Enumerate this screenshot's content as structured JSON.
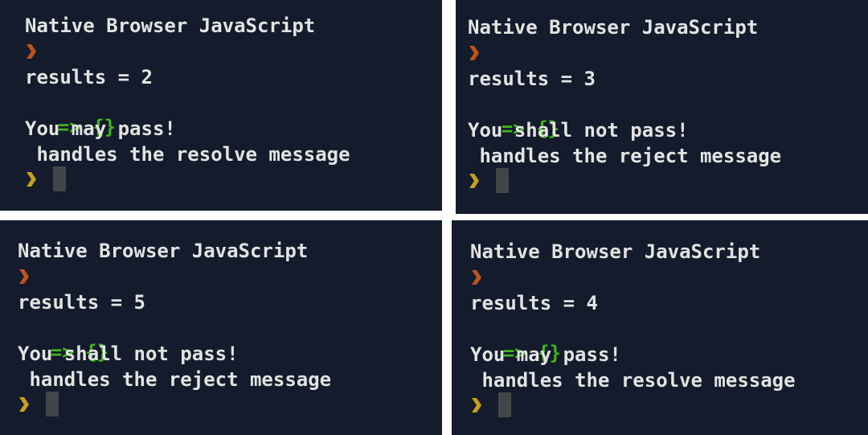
{
  "panels": [
    {
      "title": "Native Browser JavaScript",
      "results_line": "results = 2",
      "return_arrow": "=>",
      "return_value": "{}",
      "message": "You may pass!",
      "handler_line": " handles the resolve message",
      "prompt_icon": "chevron-prompt-icon",
      "colors": {
        "prompt_top": "#c0531a",
        "prompt_bottom": "#c9a018"
      }
    },
    {
      "title": "Native Browser JavaScript",
      "results_line": "results = 3",
      "return_arrow": "=>",
      "return_value": "{}",
      "message": "You shall not pass!",
      "handler_line": " handles the reject message",
      "prompt_icon": "chevron-prompt-icon",
      "colors": {
        "prompt_top": "#c0531a",
        "prompt_bottom": "#c9a018"
      }
    },
    {
      "title": "Native Browser JavaScript",
      "results_line": "results = 5",
      "return_arrow": "=>",
      "return_value": "{}",
      "message": "You shall not pass!",
      "handler_line": " handles the reject message",
      "prompt_icon": "chevron-prompt-icon",
      "colors": {
        "prompt_top": "#c0531a",
        "prompt_bottom": "#c9a018"
      }
    },
    {
      "title": "Native Browser JavaScript",
      "results_line": "results = 4",
      "return_arrow": "=>",
      "return_value": "{}",
      "message": "You may pass!",
      "handler_line": " handles the resolve message",
      "prompt_icon": "chevron-prompt-icon",
      "colors": {
        "prompt_top": "#c0531a",
        "prompt_bottom": "#c9a018"
      }
    }
  ],
  "theme": {
    "background": "#131b2c",
    "text": "#e3e3e3",
    "return_green": "#41b51c",
    "cursor": "#424649"
  }
}
